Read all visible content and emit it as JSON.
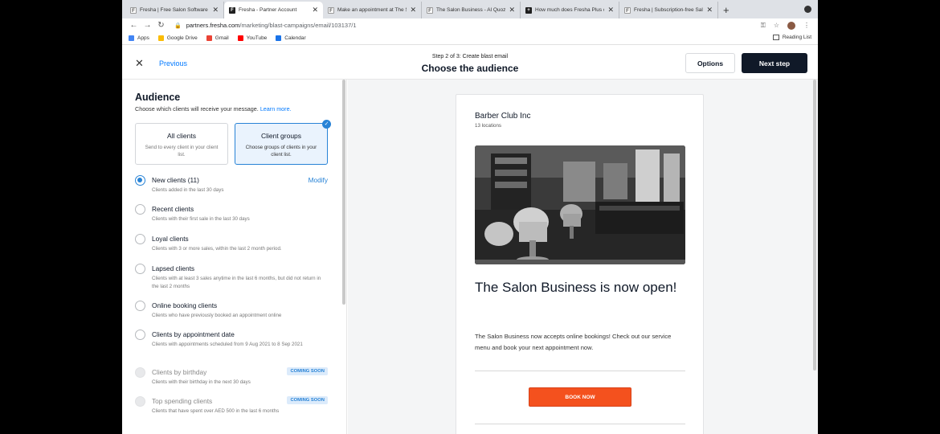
{
  "browser": {
    "tabs": [
      {
        "title": "Fresha | Free Salon Software | ...",
        "favicon": "fresha-logo",
        "active": false
      },
      {
        "title": "Fresha - Partner Account",
        "favicon": "fresha-logo",
        "active": true
      },
      {
        "title": "Make an appointment at The Sa...",
        "favicon": "fresha-logo",
        "active": false
      },
      {
        "title": "The Salon Business - Al Quoz/...",
        "favicon": "fresha-logo",
        "active": false
      },
      {
        "title": "How much does Fresha Plus c...",
        "favicon": "plus-logo",
        "active": false
      },
      {
        "title": "Fresha | Subscription-free Salo...",
        "favicon": "fresha-logo",
        "active": false
      }
    ],
    "new_tab": "+",
    "url_host": "partners.fresha.com",
    "url_path": "/marketing/blast-campaigns/email/103137/1",
    "bookmarks": [
      {
        "label": "Apps",
        "icon": "apps-grid-icon",
        "color": "#4285f4"
      },
      {
        "label": "Google Drive",
        "icon": "drive-icon",
        "color": "#fbbc04"
      },
      {
        "label": "Gmail",
        "icon": "gmail-icon",
        "color": "#ea4335"
      },
      {
        "label": "YouTube",
        "icon": "youtube-icon",
        "color": "#ff0000"
      },
      {
        "label": "Calendar",
        "icon": "calendar-icon",
        "color": "#1a73e8"
      }
    ],
    "reading_list": "Reading List"
  },
  "header": {
    "previous": "Previous",
    "step": "Step 2 of 3: Create blast email",
    "title": "Choose the audience",
    "options": "Options",
    "next": "Next step"
  },
  "audience": {
    "title": "Audience",
    "subtitle": "Choose which clients will receive your message.",
    "learn_more": "Learn more.",
    "cards": [
      {
        "title": "All clients",
        "desc": "Send to every client in your client list.",
        "selected": false
      },
      {
        "title": "Client groups",
        "desc": "Choose groups of clients in your client list.",
        "selected": true
      }
    ],
    "modify": "Modify",
    "coming_soon": "COMING SOON",
    "options": [
      {
        "label": "New clients (11)",
        "desc": "Clients added in the last 30 days"
      },
      {
        "label": "Recent clients",
        "desc": "Clients with their first sale in the last 30 days"
      },
      {
        "label": "Loyal clients",
        "desc": "Clients with 3 or more sales, within the last 2 month period."
      },
      {
        "label": "Lapsed clients",
        "desc": "Clients with at least 3 sales anytime in the last 6 months, but did not return in the last 2 months"
      },
      {
        "label": "Online booking clients",
        "desc": "Clients who have previously booked an appointment online"
      },
      {
        "label": "Clients by appointment date",
        "desc": "Clients with appointments scheduled from 9 Aug 2021 to 8 Sep 2021"
      },
      {
        "label": "Clients by birthday",
        "desc": "Clients with their birthday in the next 30 days"
      },
      {
        "label": "Top spending clients",
        "desc": "Clients that have spent over AED 500 in the last 6 months"
      }
    ]
  },
  "preview": {
    "business": "Barber Club Inc",
    "locations": "13 locations",
    "headline": "The Salon Business is now open!",
    "body": "The Salon Business now accepts online bookings! Check out our service menu and book your next appointment now.",
    "cta": "BOOK NOW"
  },
  "colors": {
    "accent": "#037aff",
    "dark": "#101928",
    "cta": "#f4511e"
  }
}
